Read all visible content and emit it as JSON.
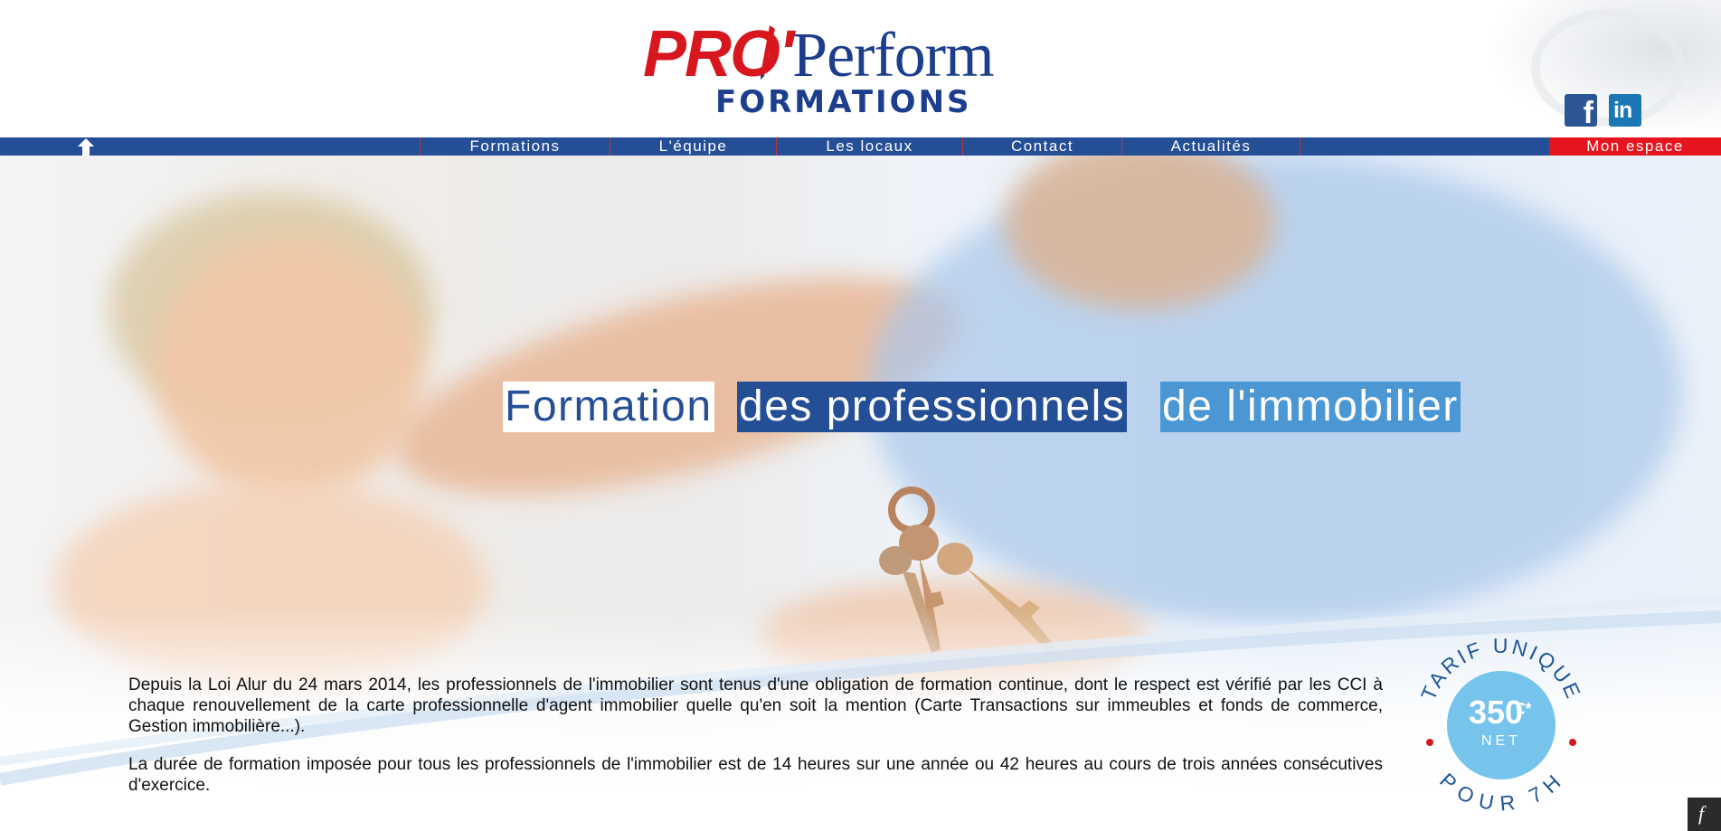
{
  "logo": {
    "brand_prefix": "PRO'",
    "brand_name": "Perform",
    "tagline": "FORMATIONS"
  },
  "social": {
    "facebook_glyph": "f",
    "linkedin_glyph": "in"
  },
  "nav": {
    "home_icon": "home-arrow-icon",
    "items": [
      {
        "label": "Formations"
      },
      {
        "label": "L'équipe"
      },
      {
        "label": "Les locaux"
      },
      {
        "label": "Contact"
      },
      {
        "label": "Actualités"
      }
    ],
    "account_label": "Mon espace"
  },
  "hero": {
    "headline_part1": "Formation",
    "headline_part2": "des professionnels",
    "headline_part3": "de l'immobilier",
    "paragraph1": "Depuis la Loi Alur du 24 mars 2014, les professionnels de l'immobilier sont tenus d'une obligation de formation continue, dont le respect est vérifié par les CCI à chaque renouvellement de la carte professionnelle d'agent immobilier quelle qu'en soit la mention (Carte Transactions sur immeubles et fonds de commerce, Gestion immobilière...).",
    "paragraph2": "La durée de formation imposée pour tous les professionnels de l'immobilier est de 14 heures sur une année ou 42 heures au cours de trois années consécutives d'exercice."
  },
  "badge": {
    "top_arc": "TARIF UNIQUE",
    "price": "350",
    "currency": "€*",
    "net": "NET",
    "bottom_arc": "POUR 7H"
  },
  "colors": {
    "brand_red": "#d7161e",
    "brand_blue": "#1c3e8c",
    "nav_blue": "#244e96",
    "light_blue": "#4b97d3",
    "badge_blue": "#76c3ec",
    "account_red": "#e6141e"
  },
  "corner_glyph": "f"
}
